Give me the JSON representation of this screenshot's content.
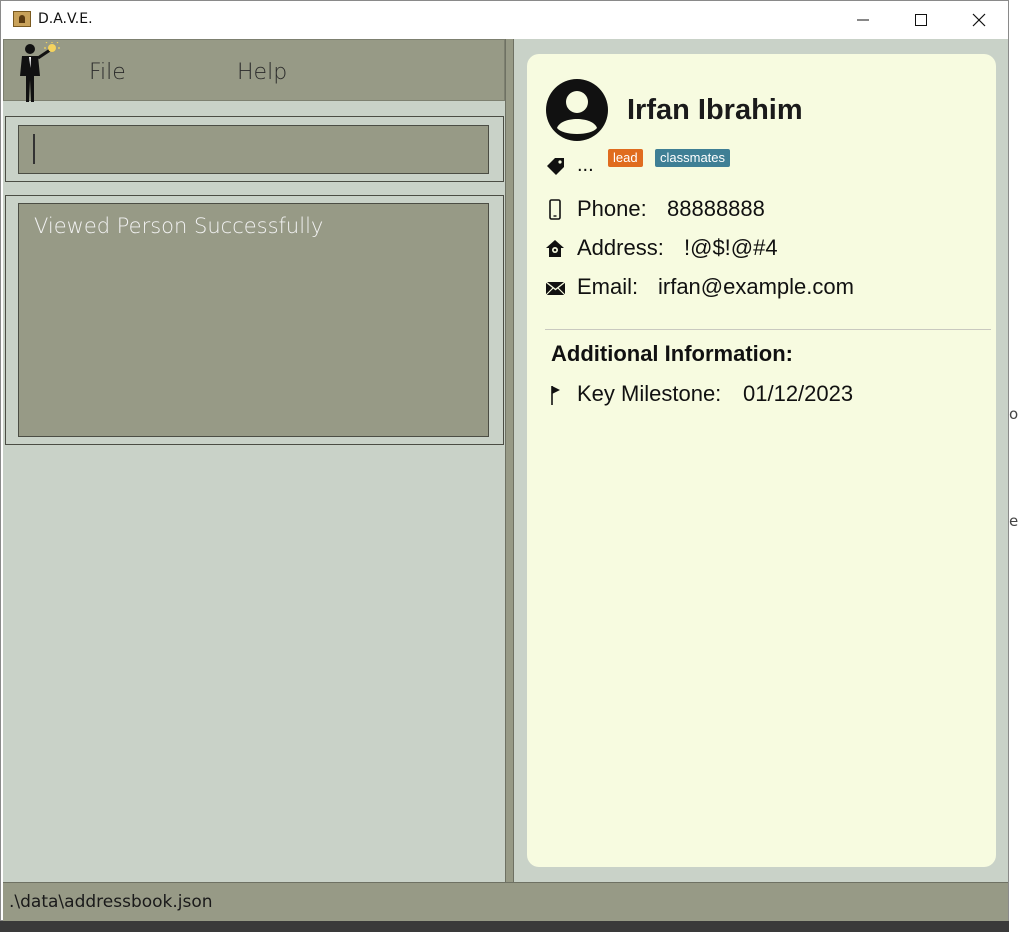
{
  "window": {
    "title": "D.A.V.E."
  },
  "menu": {
    "file": "File",
    "help": "Help"
  },
  "command": {
    "value": ""
  },
  "result": {
    "message": "Viewed Person Successfully"
  },
  "person": {
    "name": "Irfan Ibrahim",
    "tags_prefix": "...",
    "tags": [
      {
        "label": "lead",
        "color": "#e06c1f"
      },
      {
        "label": "classmates",
        "color": "#3f7f95"
      }
    ],
    "phone_label": "Phone:",
    "phone": "88888888",
    "address_label": "Address:",
    "address": "!@$!@#4",
    "email_label": "Email:",
    "email": "irfan@example.com",
    "additional_heading": "Additional Information:",
    "milestone_label": "Key Milestone:",
    "milestone": "01/12/2023"
  },
  "status": {
    "path": ".\\data\\addressbook.json"
  },
  "colors": {
    "panel_bg": "#c9d2c8",
    "bar_bg": "#979a86",
    "card_bg": "#f7fbe0"
  }
}
